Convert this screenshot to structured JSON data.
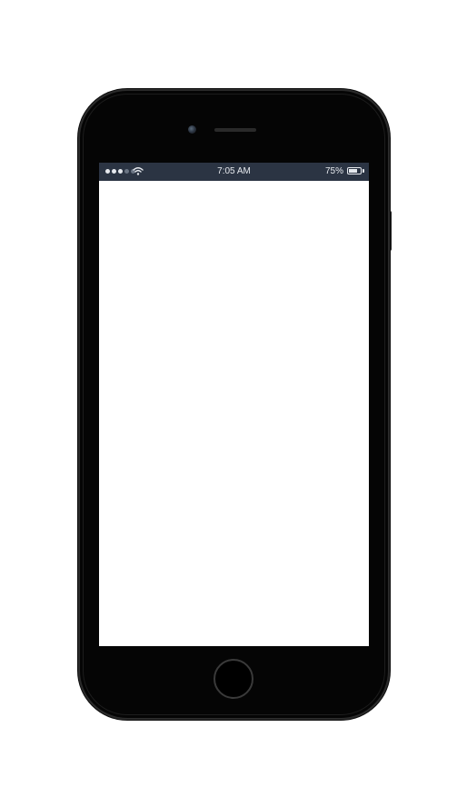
{
  "status_bar": {
    "signal_bars": 5,
    "signal_active": 3,
    "time": "7:05 AM",
    "battery_percent": "75%",
    "battery_level": 0.75,
    "wifi_icon": "wifi-icon",
    "battery_icon": "battery-icon",
    "background_color": "#2b3443"
  },
  "screen": {
    "background_color": "#ffffff"
  },
  "device": {
    "frame_color": "#050505"
  }
}
